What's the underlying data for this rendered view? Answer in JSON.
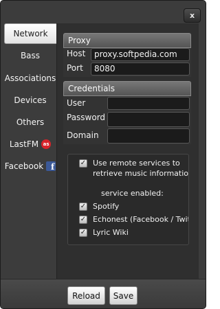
{
  "window": {
    "close_label": "x"
  },
  "sidebar": {
    "items": [
      {
        "label": "Network"
      },
      {
        "label": "Bass"
      },
      {
        "label": "Associations"
      },
      {
        "label": "Devices"
      },
      {
        "label": "Others"
      },
      {
        "label": "LastFM",
        "icon": "lastfm-icon",
        "icon_text": "as"
      },
      {
        "label": "Facebook",
        "icon": "facebook-icon",
        "icon_text": "f"
      }
    ]
  },
  "proxy": {
    "title": "Proxy",
    "host_label": "Host",
    "host_value": "proxy.softpedia.com",
    "port_label": "Port",
    "port_value": "8080"
  },
  "credentials": {
    "title": "Credentials",
    "user_label": "User",
    "user_value": "",
    "password_label": "Password",
    "password_value": "",
    "domain_label": "Domain",
    "domain_value": ""
  },
  "remote_services": {
    "use_remote_label_1": "Use remote services to",
    "use_remote_label_2": "retrieve music information",
    "use_remote_checked": true,
    "service_enabled_label": "service enabled:",
    "services": [
      {
        "label": "Spotify",
        "checked": true
      },
      {
        "label": "Echonest (Facebook / Twitter",
        "checked": true
      },
      {
        "label": "Lyric Wiki",
        "checked": true
      }
    ]
  },
  "buttons": {
    "reload": "Reload",
    "save": "Save"
  },
  "colors": {
    "window_bg": "#3c3c3c",
    "panel_bg": "#2f2f2f",
    "header_bg": "#666666",
    "lastfm_red": "#d8232a",
    "facebook_blue": "#3b5998"
  }
}
